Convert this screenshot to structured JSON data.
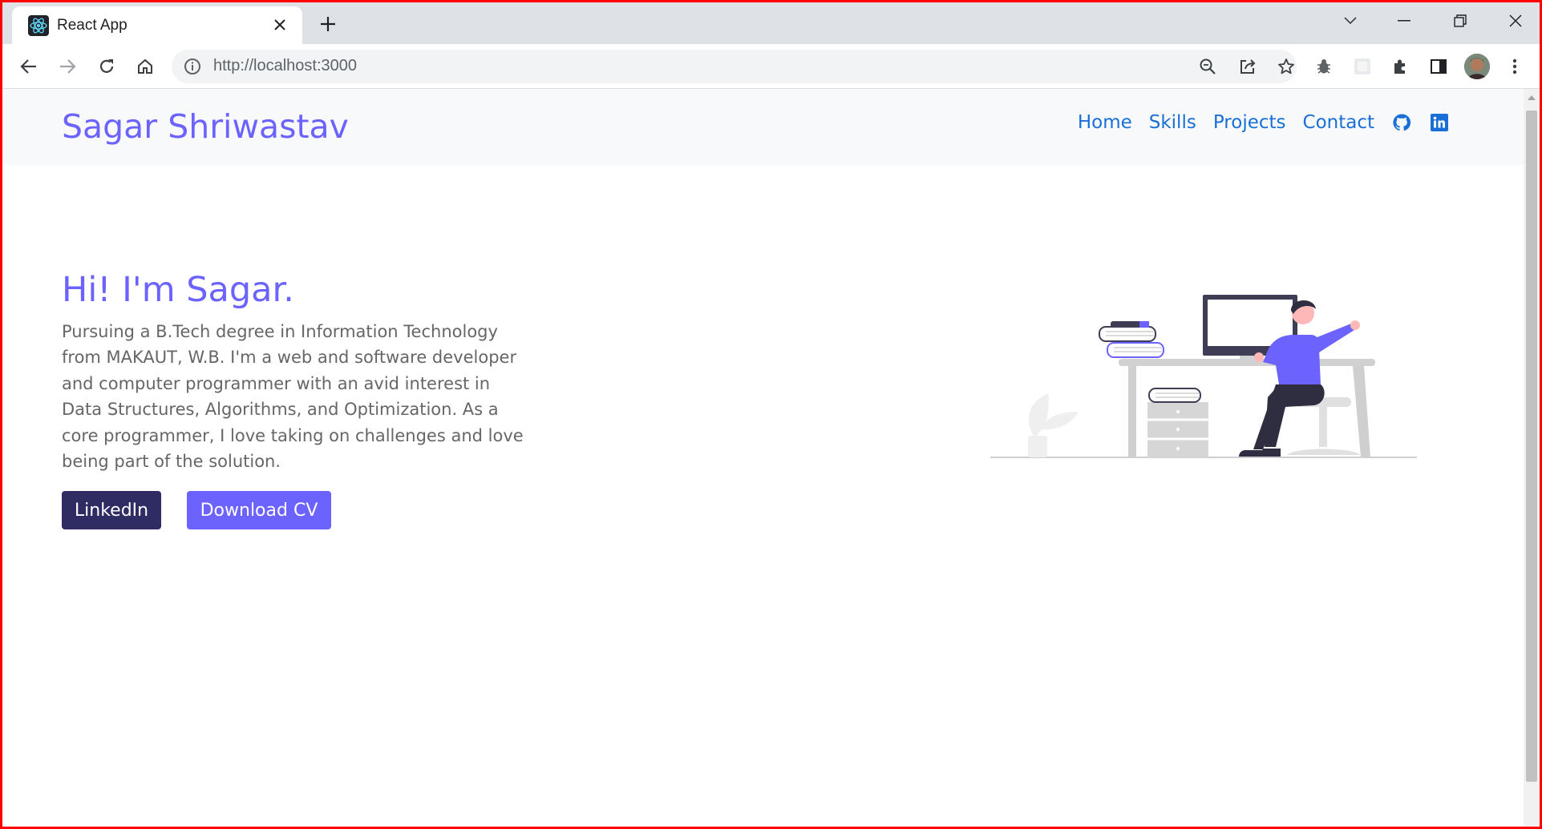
{
  "browser": {
    "tab_title": "React App",
    "url_host": "http://localhost",
    "url_port": ":3000"
  },
  "site": {
    "brand": "Sagar Shriwastav",
    "nav": [
      "Home",
      "Skills",
      "Projects",
      "Contact"
    ],
    "nav_icons": [
      "github-icon",
      "linkedin-icon"
    ],
    "colors": {
      "accent": "#6c63ff",
      "link": "#1a6fd6",
      "dark_button": "#2f2b63"
    }
  },
  "hero": {
    "title": "Hi! I'm Sagar.",
    "description": "Pursuing a B.Tech degree in Information Technology from MAKAUT, W.B. I'm a web and software developer and computer programmer with an avid interest in Data Structures, Algorithms, and Optimization. As a core programmer, I love taking on challenges and love being part of the solution.",
    "buttons": {
      "linkedin": "LinkedIn",
      "download_cv": "Download CV"
    }
  }
}
